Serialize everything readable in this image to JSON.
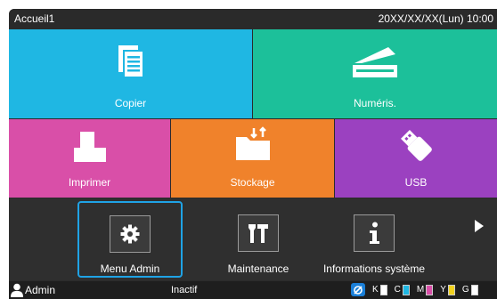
{
  "titlebar": {
    "title": "Accueil1",
    "datetime": "20XX/XX/XX(Lun) 10:00"
  },
  "tiles": {
    "copy": {
      "label": "Copier",
      "icon": "document-copy-icon",
      "color": "#1fb7e3"
    },
    "scan": {
      "label": "Numéris.",
      "icon": "scanner-icon",
      "color": "#1cc09a"
    },
    "print": {
      "label": "Imprimer",
      "icon": "printer-icon",
      "color": "#d94fa8"
    },
    "storage": {
      "label": "Stockage",
      "icon": "folder-transfer-icon",
      "color": "#f0822b"
    },
    "usb": {
      "label": "USB",
      "icon": "usb-drive-icon",
      "color": "#9b41c0"
    }
  },
  "apps": {
    "admin": {
      "label": "Menu Admin",
      "icon": "gear-icon",
      "selected": true
    },
    "maintenance": {
      "label": "Maintenance",
      "icon": "tools-icon"
    },
    "info": {
      "label": "Informations système",
      "icon": "info-icon"
    }
  },
  "status": {
    "user": "Admin",
    "state": "Inactif",
    "inks": [
      {
        "letter": "K",
        "color": "#ffffff",
        "level": 0
      },
      {
        "letter": "C",
        "color": "#1fb7e3",
        "level": 1
      },
      {
        "letter": "M",
        "color": "#d94fa8",
        "level": 1
      },
      {
        "letter": "Y",
        "color": "#f1d21e",
        "level": 1
      },
      {
        "letter": "G",
        "color": "#ffffff",
        "level": 0
      }
    ]
  }
}
